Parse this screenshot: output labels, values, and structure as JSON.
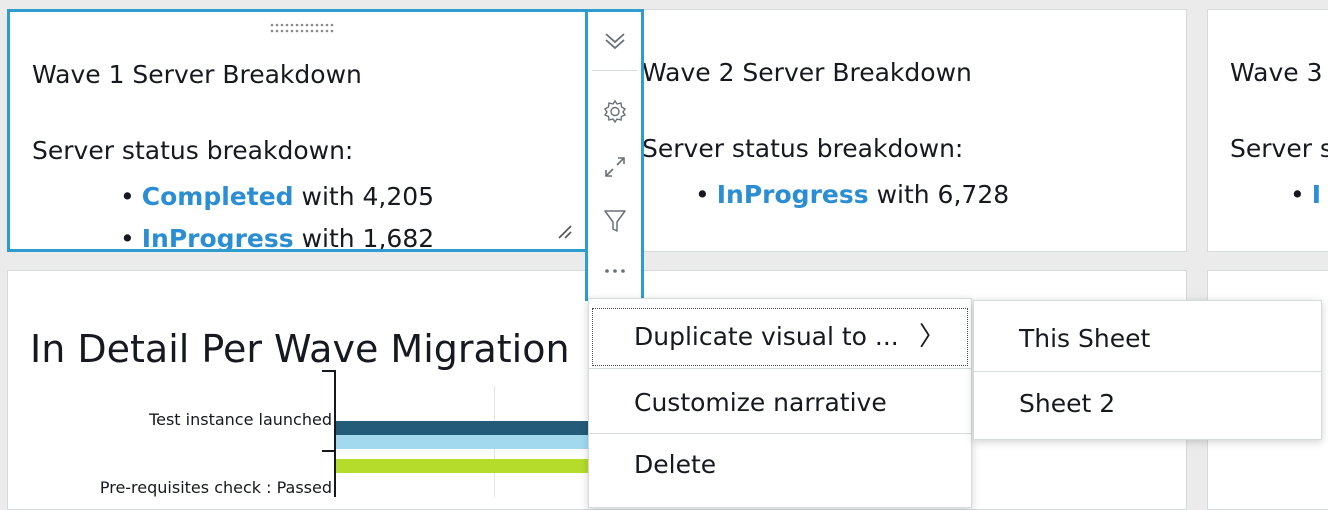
{
  "cards": [
    {
      "title": "Wave 1 Server Breakdown",
      "subtitle": "Server status breakdown:",
      "items": [
        {
          "status": "Completed",
          "text": " with 4,205"
        },
        {
          "status": "InProgress",
          "text": " with 1,682"
        }
      ]
    },
    {
      "title": "Wave 2 Server Breakdown",
      "subtitle": "Server status breakdown:",
      "items": [
        {
          "status": "InProgress",
          "text": " with 6,728"
        }
      ]
    },
    {
      "title": "Wave 3",
      "subtitle": "Server s",
      "items": [
        {
          "status": "I",
          "text": ""
        }
      ]
    }
  ],
  "toolbar": {
    "icons": [
      "collapse-icon",
      "gear-icon",
      "expand-icon",
      "filter-icon",
      "more-icon"
    ]
  },
  "detail_chart": {
    "title": "In Detail Per Wave Migration",
    "bars": [
      {
        "category": "Test instance launched",
        "colors": [
          "#235b78",
          "#a3d9ef"
        ]
      },
      {
        "category": "Pre-requisites check : Passed",
        "colors": [
          "#b5dc2b"
        ]
      }
    ]
  },
  "context_menu": {
    "items": [
      "Duplicate visual to ...",
      "Customize narrative",
      "Delete"
    ],
    "submenu_indicator": "〉"
  },
  "submenu": {
    "items": [
      "This Sheet",
      "Sheet 2"
    ]
  },
  "colors": {
    "accent": "#2f9ccf",
    "link": "#2b8ed4",
    "text": "#16191f",
    "border": "#d5dbdb"
  }
}
